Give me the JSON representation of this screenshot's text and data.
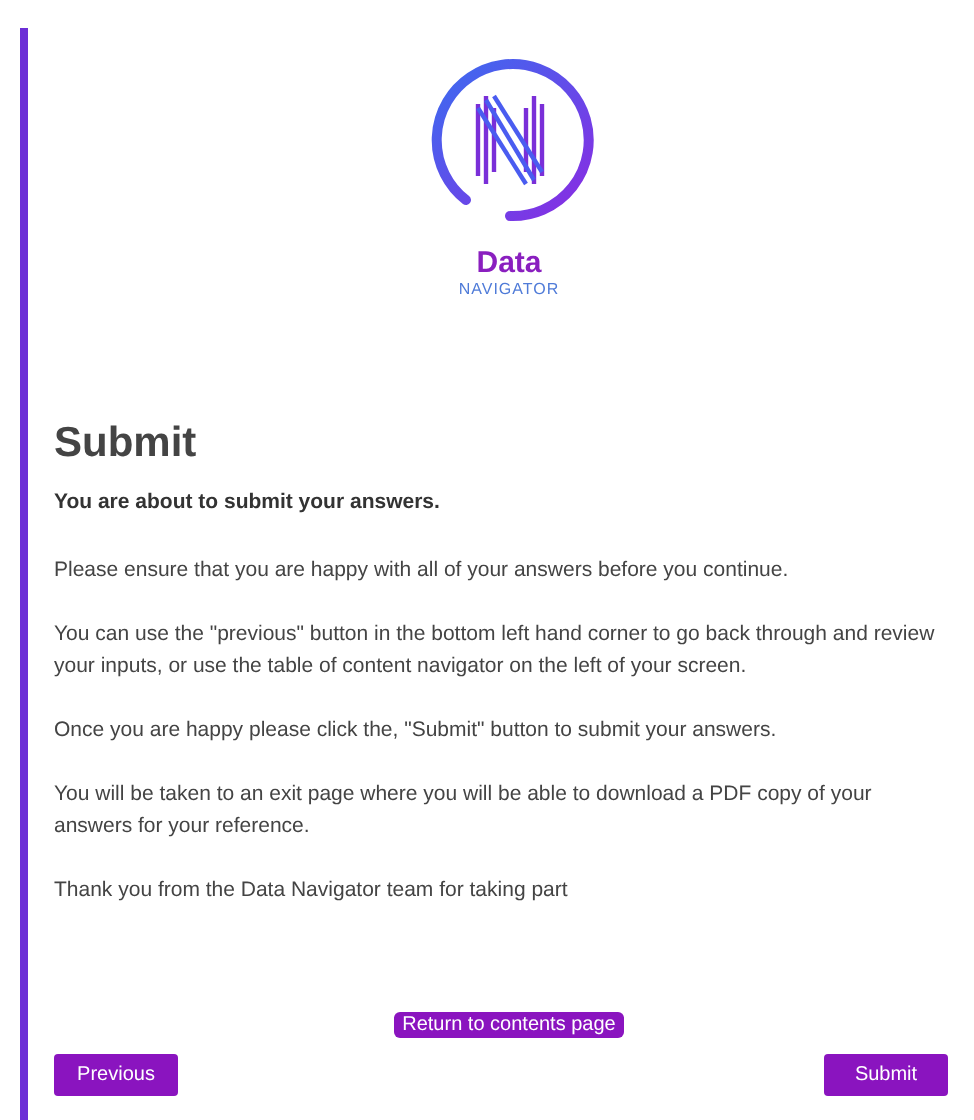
{
  "logo": {
    "title": "Data",
    "subtitle": "NAVIGATOR"
  },
  "heading": "Submit",
  "intro": "You are about to submit your answers.",
  "paragraphs": [
    "Please ensure that you are happy with all of your answers before you continue.",
    "You can use the \"previous\" button in the bottom left hand corner to go back through and review your inputs, or use the table of content navigator on the left of your screen.",
    "Once you are happy please click the, \"Submit\" button to submit your answers.",
    "You will be taken to an exit page where you will be able to download a PDF copy of your answers for your reference.",
    "Thank you from the Data Navigator team for taking part"
  ],
  "return_link": "Return to contents page",
  "buttons": {
    "previous": "Previous",
    "submit": "Submit"
  }
}
